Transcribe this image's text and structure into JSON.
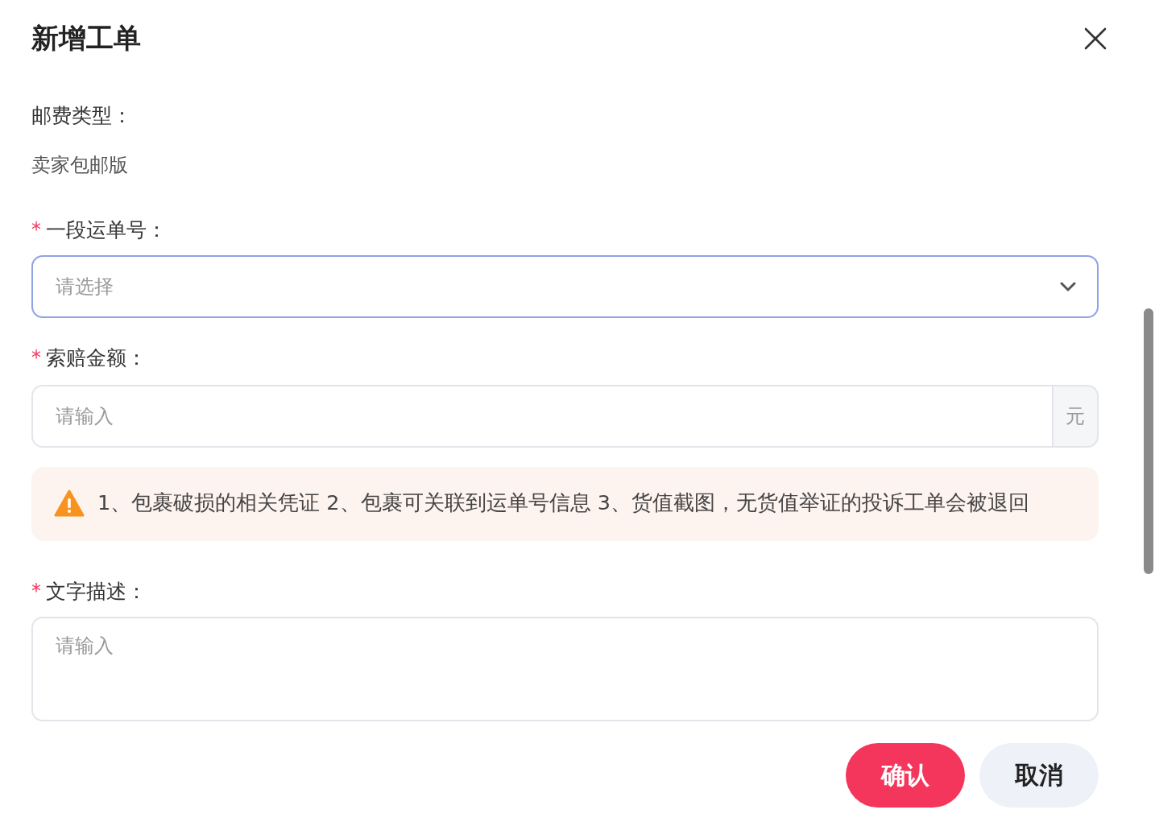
{
  "dialog": {
    "title": "新增工单"
  },
  "fields": [
    {
      "kind": "static",
      "label": "邮费类型：",
      "value": "卖家包邮版"
    },
    {
      "kind": "select",
      "label": "一段运单号：",
      "required_mark": "*",
      "placeholder": "请选择",
      "focused": true
    },
    {
      "kind": "amount",
      "label": "索赔金额：",
      "required_mark": "*",
      "placeholder": "请输入",
      "suffix": "元",
      "focused": false
    },
    {
      "kind": "notice",
      "text": "1、包裹破损的相关凭证 2、包裹可关联到运单号信息 3、货值截图，无货值举证的投诉工单会被退回"
    },
    {
      "kind": "textarea",
      "label": "文字描述：",
      "required_mark": "*",
      "placeholder": "请输入",
      "focused": false
    }
  ],
  "buttons": [
    {
      "label": "确认",
      "kind": "primary"
    },
    {
      "label": "取消",
      "kind": "secondary"
    }
  ]
}
